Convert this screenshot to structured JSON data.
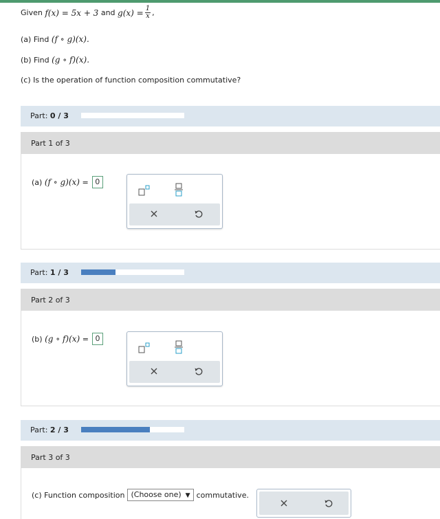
{
  "problem": {
    "given_prefix": "Given",
    "f_def": "f(x) = 5x + 3",
    "and_word": "and",
    "g_left": "g(x) =",
    "g_num": "1",
    "g_den": "x",
    "comma": ",",
    "qa": "(a) Find",
    "qa_expr": "(f ∘ g)(x).",
    "qb": "(b) Find",
    "qb_expr": "(g ∘ f)(x).",
    "qc": "(c) Is the operation of function composition commutative?"
  },
  "progress": [
    {
      "label": "Part:",
      "value": "0 / 3",
      "fraction": 0.0
    },
    {
      "label": "Part:",
      "value": "1 / 3",
      "fraction": 0.3333
    },
    {
      "label": "Part:",
      "value": "2 / 3",
      "fraction": 0.6667
    }
  ],
  "parts": [
    {
      "header": "Part 1 of 3",
      "prefix": "(a)",
      "expr": "(f ∘ g)(x)",
      "eq": "=",
      "answer": "0"
    },
    {
      "header": "Part 2 of 3",
      "prefix": "(b)",
      "expr": "(g ∘ f)(x)",
      "eq": "=",
      "answer": "0"
    },
    {
      "header": "Part 3 of 3",
      "prefix": "(c) Function composition",
      "select": "(Choose one)",
      "arrow": "▼",
      "suffix": "commutative."
    }
  ],
  "icons": [
    "square-superscript-icon",
    "fraction-icon",
    "clear-x-icon",
    "undo-icon"
  ],
  "colors": {
    "topbar": "#4e9a6f",
    "progress_fill": "#4a7fbf",
    "part_bar": "#dce6ef",
    "part_header": "#dcdcdc"
  }
}
